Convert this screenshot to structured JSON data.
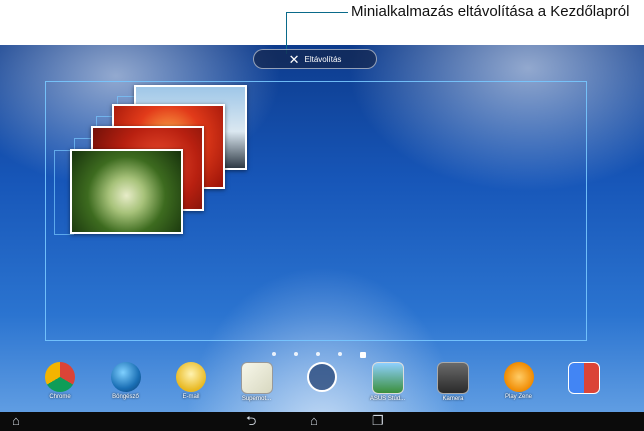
{
  "callout": {
    "text": "Minialkalmazás eltávolítása a Kezdőlapról"
  },
  "remove_button": {
    "label": "Eltávolítás",
    "icon": "close-icon"
  },
  "dock": {
    "apps": [
      {
        "label": "Chrome",
        "icon": "chrome-icon"
      },
      {
        "label": "Böngésző",
        "icon": "browser-icon"
      },
      {
        "label": "E-mail",
        "icon": "email-icon"
      },
      {
        "label": "Supernot...",
        "icon": "supernote-icon"
      },
      {
        "label": "",
        "icon": "all-apps-icon"
      },
      {
        "label": "ASUS Stúd...",
        "icon": "gallery-icon"
      },
      {
        "label": "Kamera",
        "icon": "camera-icon"
      },
      {
        "label": "Play Zene",
        "icon": "play-music-icon"
      },
      {
        "label": "",
        "icon": "google-apps-icon"
      }
    ]
  },
  "navbar": {
    "icons": [
      "back-icon",
      "home-icon",
      "recent-apps-icon"
    ]
  }
}
